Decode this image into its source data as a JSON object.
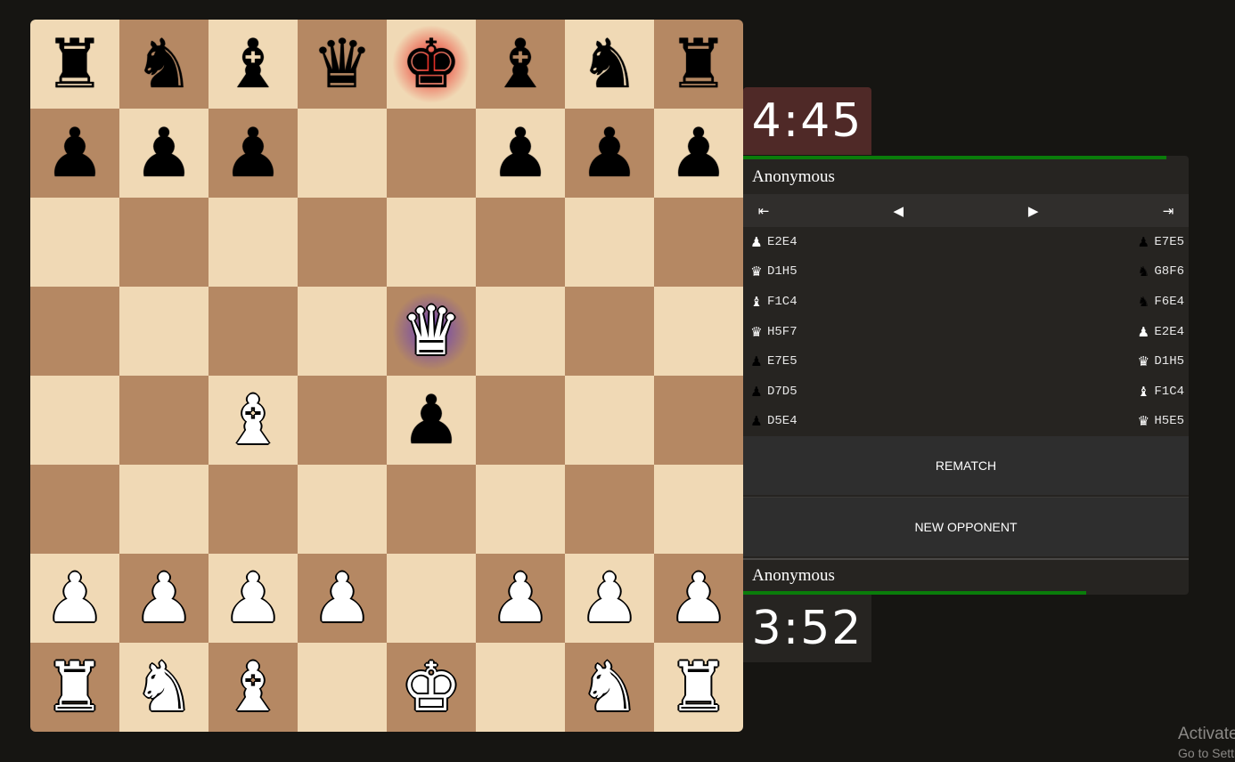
{
  "board": {
    "rows": [
      [
        "br",
        "bn",
        "bb",
        "bq",
        "bk",
        "bb",
        "bn",
        "br"
      ],
      [
        "bp",
        "bp",
        "bp",
        "",
        "",
        "bp",
        "bp",
        "bp"
      ],
      [
        "",
        "",
        "",
        "",
        "",
        "",
        "",
        ""
      ],
      [
        "",
        "",
        "",
        "",
        "wq",
        "",
        "",
        ""
      ],
      [
        "",
        "",
        "wb",
        "",
        "bp",
        "",
        "",
        ""
      ],
      [
        "",
        "",
        "",
        "",
        "",
        "",
        "",
        ""
      ],
      [
        "wp",
        "wp",
        "wp",
        "wp",
        "",
        "wp",
        "wp",
        "wp"
      ],
      [
        "wr",
        "wn",
        "wb",
        "",
        "wk",
        "",
        "wn",
        "wr"
      ]
    ],
    "check_square": "e8",
    "selected_square": "e5",
    "colors": {
      "light": "#f0d9b5",
      "dark": "#b58863"
    }
  },
  "glyphs": {
    "k": "♚",
    "q": "♛",
    "r": "♜",
    "b": "♝",
    "n": "♞",
    "p": "♟"
  },
  "top_clock": {
    "time": "4:45",
    "bar_fraction": 0.95
  },
  "bottom_clock": {
    "time": "3:52",
    "bar_fraction": 0.77
  },
  "top_player": {
    "name": "Anonymous"
  },
  "bottom_player": {
    "name": "Anonymous"
  },
  "controls": {
    "first": "⇤",
    "prev": "◀",
    "next": "▶",
    "last": "⇥"
  },
  "moves": [
    {
      "left": {
        "piece": "p",
        "color": "w",
        "text": "E2E4"
      },
      "right": {
        "piece": "p",
        "color": "b",
        "text": "E7E5"
      }
    },
    {
      "left": {
        "piece": "q",
        "color": "w",
        "text": "D1H5"
      },
      "right": {
        "piece": "n",
        "color": "b",
        "text": "G8F6"
      }
    },
    {
      "left": {
        "piece": "b",
        "color": "w",
        "text": "F1C4"
      },
      "right": {
        "piece": "n",
        "color": "b",
        "text": "F6E4"
      }
    },
    {
      "left": {
        "piece": "q",
        "color": "w",
        "text": "H5F7"
      },
      "right": {
        "piece": "p",
        "color": "w",
        "text": "E2E4"
      }
    },
    {
      "left": {
        "piece": "p",
        "color": "b",
        "text": "E7E5"
      },
      "right": {
        "piece": "q",
        "color": "w",
        "text": "D1H5"
      }
    },
    {
      "left": {
        "piece": "p",
        "color": "b",
        "text": "D7D5"
      },
      "right": {
        "piece": "b",
        "color": "w",
        "text": "F1C4"
      }
    },
    {
      "left": {
        "piece": "p",
        "color": "b",
        "text": "D5E4"
      },
      "right": {
        "piece": "q",
        "color": "w",
        "text": "H5E5"
      }
    }
  ],
  "buttons": {
    "rematch": "REMATCH",
    "new_opponent": "NEW OPPONENT"
  },
  "watermark": {
    "line1": "Activate",
    "line2": "Go to Settings"
  }
}
